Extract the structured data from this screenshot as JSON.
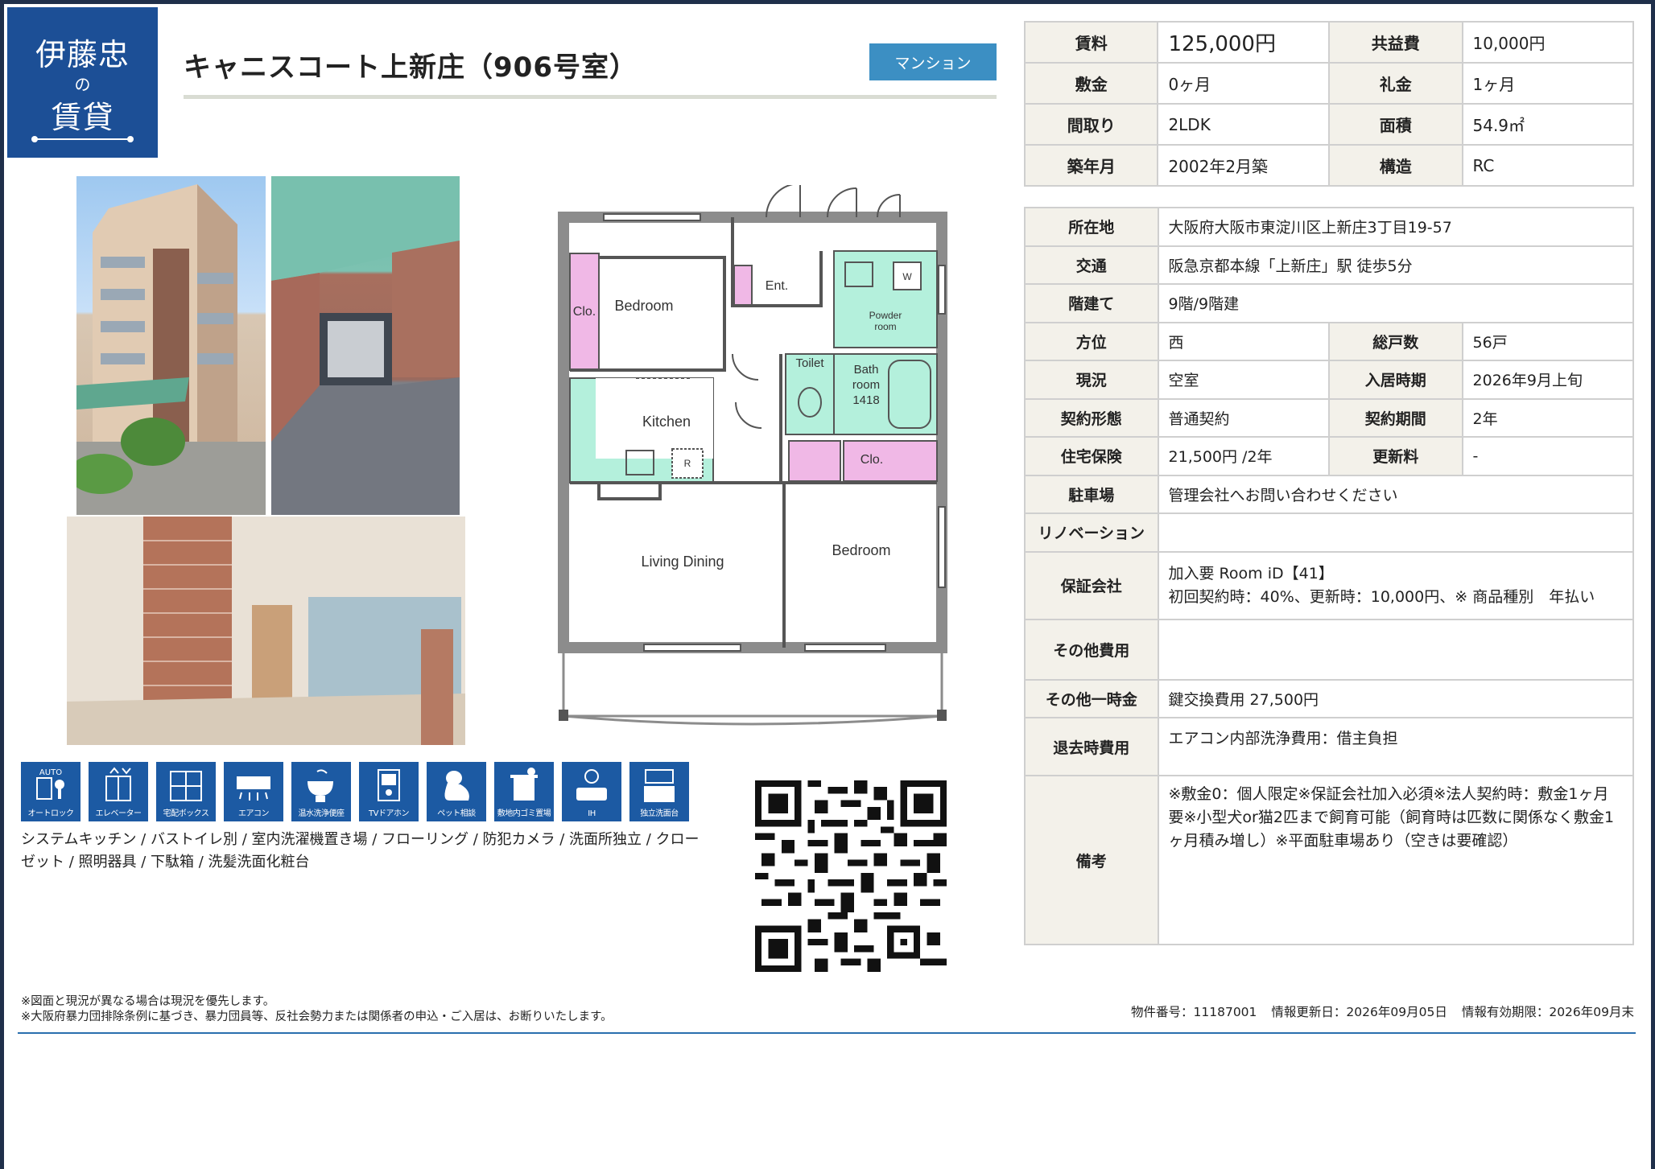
{
  "logo": {
    "line1": "伊藤忠",
    "line2": "の",
    "line3": "賃貸"
  },
  "title": "キャニスコート上新庄（906号室）",
  "property_type": "マンション",
  "floorplan": {
    "bedroom1": "Bedroom",
    "closet1": "Clo.",
    "entrance": "Ent.",
    "powder": "Powder",
    "powder2": "room",
    "washer": "W",
    "toilet": "Toilet",
    "bath1": "Bath",
    "bath2": "room",
    "bath3": "1418",
    "kitchen": "Kitchen",
    "fridge": "R",
    "closet2": "Clo.",
    "living": "Living Dining",
    "bedroom2": "Bedroom"
  },
  "amenities": [
    {
      "icon": "auto-lock-icon",
      "label": "オートロック",
      "top": "AUTO"
    },
    {
      "icon": "elevator-icon",
      "label": "エレベーター"
    },
    {
      "icon": "delivery-box-icon",
      "label": "宅配ボックス"
    },
    {
      "icon": "air-conditioner-icon",
      "label": "エアコン"
    },
    {
      "icon": "washlet-icon",
      "label": "温水洗浄便座"
    },
    {
      "icon": "tv-intercom-icon",
      "label": "TVドアホン"
    },
    {
      "icon": "pet-icon",
      "label": "ペット相談"
    },
    {
      "icon": "garbage-icon",
      "label": "敷地内ゴミ置場"
    },
    {
      "icon": "ih-icon",
      "label": "IH"
    },
    {
      "icon": "vanity-icon",
      "label": "独立洗面台"
    }
  ],
  "features": "システムキッチン / バストイレ別 / 室内洗濯機置き場 / フローリング / 防犯カメラ / 洗面所独立 / クローゼット / 照明器具 / 下駄箱 / 洗髪洗面化粧台",
  "summary": {
    "rent_label": "賃料",
    "rent": "125,000円",
    "common_label": "共益費",
    "common": "10,000円",
    "deposit_label": "敷金",
    "deposit": "0ヶ月",
    "key_money_label": "礼金",
    "key_money": "1ヶ月",
    "layout_label": "間取り",
    "layout": "2LDK",
    "area_label": "面積",
    "area": "54.9㎡",
    "built_label": "築年月",
    "built": "2002年2月築",
    "structure_label": "構造",
    "structure": "RC"
  },
  "details": {
    "address_label": "所在地",
    "address": "大阪府大阪市東淀川区上新庄3丁目19-57",
    "access_label": "交通",
    "access": "阪急京都本線「上新庄」駅 徒歩5分",
    "floor_label": "階建て",
    "floor": "9階/9階建",
    "direction_label": "方位",
    "direction": "西",
    "units_label": "総戸数",
    "units": "56戸",
    "status_label": "現況",
    "status": "空室",
    "move_in_label": "入居時期",
    "move_in": "2026年9月上旬",
    "contract_type_label": "契約形態",
    "contract_type": "普通契約",
    "contract_period_label": "契約期間",
    "contract_period": "2年",
    "insurance_label": "住宅保険",
    "insurance": "21,500円 /2年",
    "renewal_label": "更新料",
    "renewal": "-",
    "parking_label": "駐車場",
    "parking": "管理会社へお問い合わせください",
    "renovation_label": "リノベーション",
    "renovation": "",
    "guarantor_label": "保証会社",
    "guarantor_line1": "加入要 Room iD【41】",
    "guarantor_line2": "初回契約時：40%、更新時：10,000円、※ 商品種別　年払い",
    "other_fees_label": "その他費用",
    "other_fees": "",
    "other_onetime_label": "その他一時金",
    "other_onetime": "鍵交換費用 27,500円",
    "moveout_label": "退去時費用",
    "moveout": "エアコン内部洗浄費用：借主負担",
    "remarks_label": "備考",
    "remarks": "※敷金0：個人限定※保証会社加入必須※法人契約時：敷金1ヶ月要※小型犬or猫2匹まで飼育可能（飼育時は匹数に関係なく敷金1ヶ月積み増し）※平面駐車場あり（空きは要確認）"
  },
  "footer": {
    "note1": "※図面と現況が異なる場合は現況を優先します。",
    "note2": "※大阪府暴力団排除条例に基づき、暴力団員等、反社会勢力または関係者の申込・ご入居は、お断りいたします。",
    "property_no": "物件番号：11187001",
    "updated": "情報更新日：2026年09月05日",
    "valid": "情報有効期限：2026年09月末"
  },
  "colors": {
    "brand": "#1c4f96",
    "badge": "#3c8fc3",
    "header_cell": "#f3f1ea",
    "wet_area": "#b4f0dc",
    "closet": "#f0b8e6"
  }
}
